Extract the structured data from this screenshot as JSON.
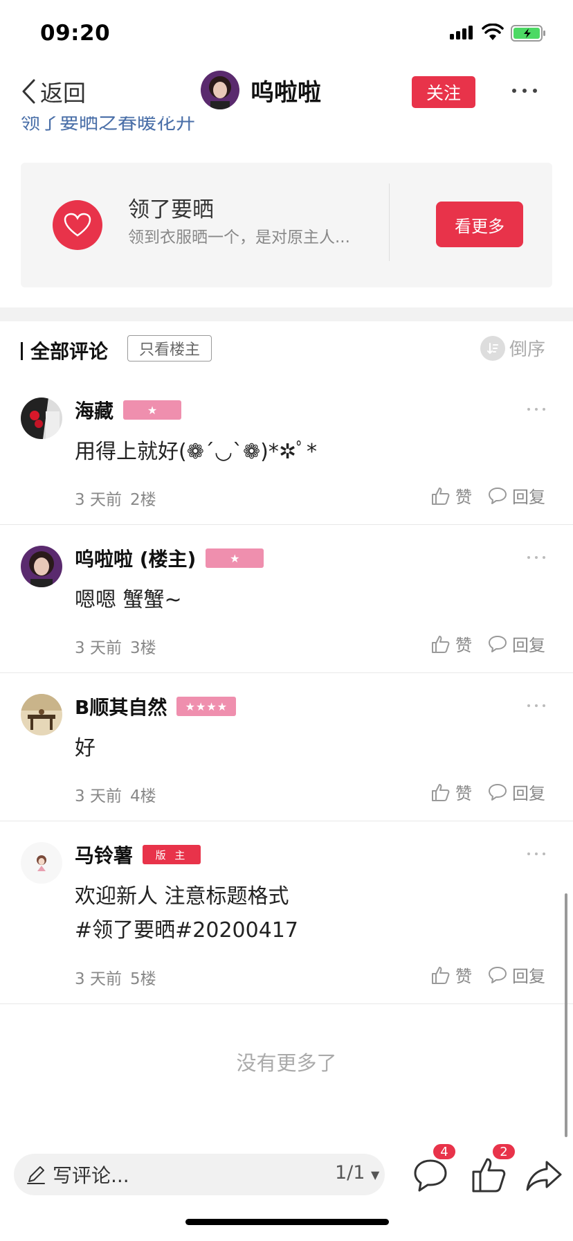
{
  "status_bar": {
    "time": "09:20"
  },
  "nav": {
    "back_label": "返回",
    "user_name": "呜啦啦",
    "follow_label": "关注"
  },
  "cut_text": "领了要晒之春暖花开",
  "card": {
    "title": "领了要晒",
    "desc": "领到衣服晒一个，是对原主人...",
    "button_label": "看更多"
  },
  "comments_header": {
    "title": "全部评论",
    "op_only_label": "只看楼主",
    "sort_label": "倒序"
  },
  "comments": [
    {
      "name": "海藏",
      "content": "用得上就好(❁´◡`❁)*✲ﾟ*",
      "time": "3 天前",
      "floor": "2楼",
      "like_label": "赞",
      "reply_label": "回复",
      "star_badge": "★"
    },
    {
      "name": "呜啦啦 (楼主)",
      "content": "嗯嗯  蟹蟹~",
      "time": "3 天前",
      "floor": "3楼",
      "like_label": "赞",
      "reply_label": "回复",
      "star_badge": "★"
    },
    {
      "name": "B顺其自然",
      "content": "好",
      "time": "3 天前",
      "floor": "4楼",
      "like_label": "赞",
      "reply_label": "回复",
      "star_badge": "★★★★"
    },
    {
      "name": "马铃薯",
      "badge_label": "版 主",
      "content_line1": "欢迎新人 注意标题格式",
      "content_line2": "#领了要晒#20200417",
      "time": "3 天前",
      "floor": "5楼",
      "like_label": "赞",
      "reply_label": "回复"
    }
  ],
  "no_more": "没有更多了",
  "bottom_bar": {
    "placeholder": "写评论...",
    "page": "1/1",
    "comment_count": "4",
    "like_count": "2"
  },
  "colors": {
    "accent": "#e8334a",
    "badge_pink": "#ef8fae",
    "link_blue": "#4a6fa8"
  }
}
